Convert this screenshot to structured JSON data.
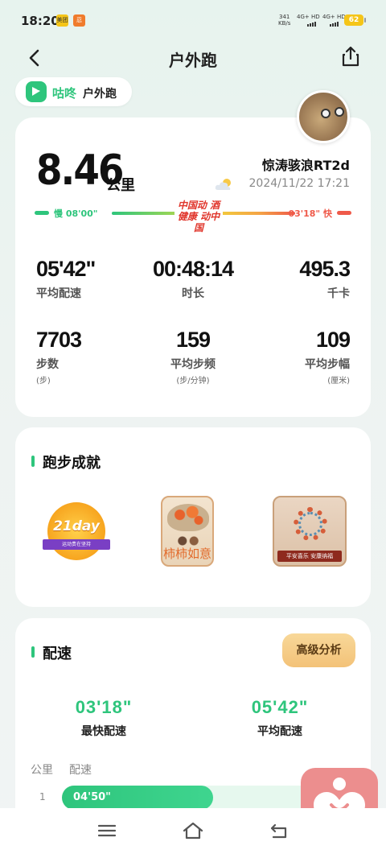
{
  "status_bar": {
    "time": "18:20",
    "app_badge_1": "美团",
    "app_badge_2": "忍",
    "net_speed_value": "341",
    "net_speed_unit": "KB/s",
    "signal_1": "4G+ HD",
    "signal_2": "4G+ HD",
    "battery": "62"
  },
  "navbar": {
    "title": "户外跑",
    "back_icon": "chevron-left-icon",
    "share_icon": "share-icon"
  },
  "brand": {
    "app_name": "咕咚",
    "sport": "户外跑"
  },
  "summary": {
    "distance": "8.46",
    "distance_unit": "公里",
    "username": "惊涛骇浪RT2d",
    "datetime": "2024/11/22 17:21",
    "weather_icon": "partly-cloudy-icon",
    "slow_label": "慢 08'00\"",
    "fast_label": "03'18\" 快",
    "stamp_line1": "中国动 酒",
    "stamp_line2": "健康 动中国",
    "colors": {
      "accent": "#2ec57c",
      "fast": "#ef5a4a"
    }
  },
  "stats": [
    {
      "value": "05'42\"",
      "label": "平均配速",
      "unit": ""
    },
    {
      "value": "00:48:14",
      "label": "时长",
      "unit": ""
    },
    {
      "value": "495.3",
      "label": "千卡",
      "unit": ""
    },
    {
      "value": "7703",
      "label": "步数",
      "unit": "(步)"
    },
    {
      "value": "159",
      "label": "平均步频",
      "unit": "(步/分钟)"
    },
    {
      "value": "109",
      "label": "平均步幅",
      "unit": "(厘米)"
    }
  ],
  "achievements": {
    "title": "跑步成就",
    "badges": [
      {
        "name": "21day",
        "ribbon": "运动贵在坚持"
      },
      {
        "name": "柿柿如意"
      },
      {
        "name": "平安喜乐 安康纳福"
      }
    ]
  },
  "pace": {
    "title": "配速",
    "advanced_button": "高级分析",
    "fastest_value": "03'18\"",
    "fastest_label": "最快配速",
    "average_value": "05'42\"",
    "average_label": "平均配速",
    "col_km": "公里",
    "col_pace": "配速",
    "rows": [
      {
        "km": "1",
        "pace": "04'50\""
      }
    ]
  },
  "bottom_nav": {
    "menu_icon": "menu-icon",
    "home_icon": "home-icon",
    "back_icon": "back-icon"
  }
}
